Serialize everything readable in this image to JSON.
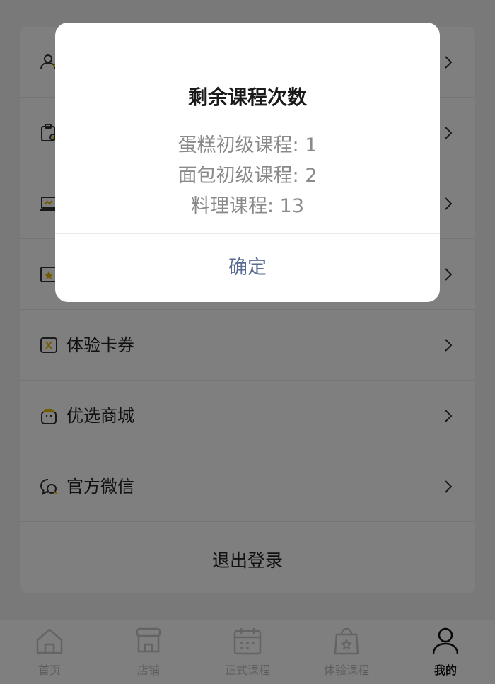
{
  "menu": {
    "items": [
      {
        "label": "",
        "icon": "user-icon"
      },
      {
        "label": "",
        "icon": "clipboard-icon"
      },
      {
        "label": "",
        "icon": "laptop-icon"
      },
      {
        "label": "",
        "icon": "star-card-icon"
      },
      {
        "label": "体验卡券",
        "icon": "ticket-icon"
      },
      {
        "label": "优选商城",
        "icon": "shopping-bag-icon"
      },
      {
        "label": "官方微信",
        "icon": "chat-icon"
      }
    ],
    "logout_label": "退出登录"
  },
  "tabbar": {
    "tabs": [
      {
        "label": "首页",
        "icon": "home-icon"
      },
      {
        "label": "店铺",
        "icon": "store-icon"
      },
      {
        "label": "正式课程",
        "icon": "calendar-icon"
      },
      {
        "label": "体验课程",
        "icon": "bag-icon"
      },
      {
        "label": "我的",
        "icon": "person-icon",
        "active": true
      }
    ]
  },
  "dialog": {
    "title": "剩余课程次数",
    "lines": [
      "蛋糕初级课程: 1",
      "面包初级课程: 2",
      "料理课程: 13"
    ],
    "confirm_label": "确定",
    "confirm_color": "#576b95"
  },
  "colors": {
    "mask": "rgba(0,0,0,0.5)",
    "icon_accent": "#e6b800"
  }
}
